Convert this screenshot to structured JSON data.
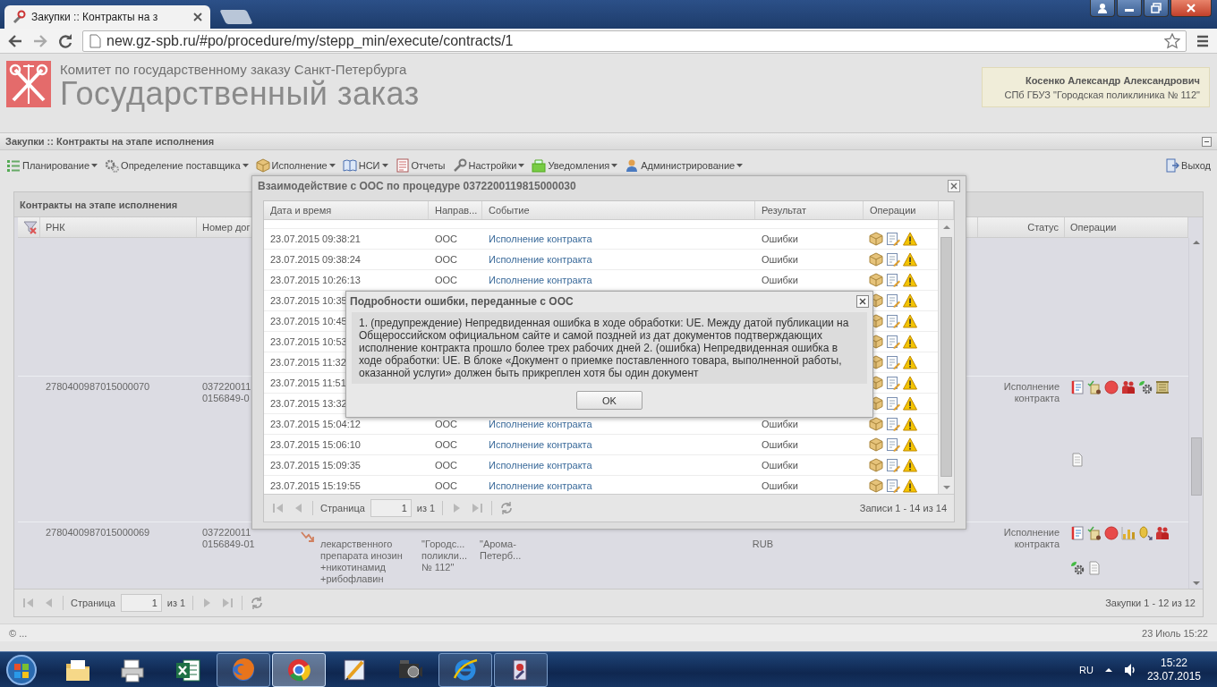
{
  "browser": {
    "tab_title": "Закупки :: Контракты на з",
    "url": "new.gz-spb.ru/#po/procedure/my/stepp_min/execute/contracts/1"
  },
  "header": {
    "org": "Комитет по государственному заказу Санкт-Петербурга",
    "title": "Государственный заказ",
    "user_name": "Косенко Александр Александрович",
    "user_org": "СПб ГБУЗ \"Городская поликлиника № 112\""
  },
  "panel_title": "Закупки :: Контракты на этапе исполнения",
  "menu": [
    {
      "label": "Планирование",
      "dropdown": true
    },
    {
      "label": "Определение поставщика",
      "dropdown": true
    },
    {
      "label": "Исполнение",
      "dropdown": true
    },
    {
      "label": "НСИ",
      "dropdown": true
    },
    {
      "label": "Отчеты",
      "dropdown": false
    },
    {
      "label": "Настройки",
      "dropdown": true
    },
    {
      "label": "Уведомления",
      "dropdown": true
    },
    {
      "label": "Администрирование",
      "dropdown": true
    }
  ],
  "logout": "Выход",
  "contracts": {
    "title": "Контракты на этапе исполнения",
    "columns": [
      "РНК",
      "Номер дог",
      "Статус",
      "Операции"
    ],
    "rows": [
      {
        "rnk": "2780400987015000070",
        "number": [
          "037220011",
          "0156849-0"
        ],
        "status": [
          "Исполнение",
          "контракта"
        ]
      },
      {
        "rnk": "2780400987015000069",
        "number": [
          "037220011",
          "0156849-01"
        ],
        "trend_icon": true,
        "subject": [
          "лекарственного",
          "препарата инозин",
          "+никотинамид",
          "+рибофлавин"
        ],
        "customer": [
          "\"Городс...",
          "поликли...",
          "№ 112\""
        ],
        "supplier": [
          "\"Арома-",
          "Петерб..."
        ],
        "price": [
          "RUB"
        ],
        "status": [
          "Исполнение",
          "контракта"
        ]
      }
    ],
    "pager": {
      "page_label": "Страница",
      "page": "1",
      "of": "из 1",
      "summary": "Закупки 1 - 12 из 12"
    }
  },
  "dialog": {
    "title": "Взаимодействие с ООС по процедуре 0372200119815000030",
    "columns": [
      "Дата и время",
      "Направ...",
      "Событие",
      "Результат",
      "Операции"
    ],
    "rows": [
      {
        "time": "23.07.2015 09:38:21",
        "direction": "ООС",
        "event": "Исполнение контракта",
        "result": "Ошибки"
      },
      {
        "time": "23.07.2015 09:38:24",
        "direction": "ООС",
        "event": "Исполнение контракта",
        "result": "Ошибки"
      },
      {
        "time": "23.07.2015 10:26:13",
        "direction": "ООС",
        "event": "Исполнение контракта",
        "result": "Ошибки"
      },
      {
        "time": "23.07.2015 10:35"
      },
      {
        "time": "23.07.2015 10:45"
      },
      {
        "time": "23.07.2015 10:53"
      },
      {
        "time": "23.07.2015 11:32"
      },
      {
        "time": "23.07.2015 11:51"
      },
      {
        "time": "23.07.2015 13:32"
      },
      {
        "time": "23.07.2015 15:04:12",
        "direction": "ООС",
        "event": "Исполнение контракта",
        "result": "Ошибки"
      },
      {
        "time": "23.07.2015 15:06:10",
        "direction": "ООС",
        "event": "Исполнение контракта",
        "result": "Ошибки"
      },
      {
        "time": "23.07.2015 15:09:35",
        "direction": "ООС",
        "event": "Исполнение контракта",
        "result": "Ошибки"
      },
      {
        "time": "23.07.2015 15:19:55",
        "direction": "ООС",
        "event": "Исполнение контракта",
        "result": "Ошибки"
      }
    ],
    "pager": {
      "page_label": "Страница",
      "page": "1",
      "of": "из 1",
      "summary": "Записи 1 - 14 из 14"
    }
  },
  "error_modal": {
    "title": "Подробности ошибки, переданные с ООС",
    "message": "1. (предупреждение) Непредвиденная ошибка в ходе обработки: UE. Между датой публикации на Общероссийском официальном сайте и самой поздней из дат документов подтверждающих исполнение контракта прошло более трех рабочих дней 2. (ошибка) Непредвиденная ошибка в ходе обработки: UE. В блоке «Документ о приемке поставленного товара, выполненной работы, оказанной услуги» должен быть прикреплен хотя бы один документ",
    "button": "OK"
  },
  "status_bar": {
    "left": "© ...",
    "right": "23 Июль 15:22"
  },
  "taskbar": {
    "apps": [
      {
        "kind": "folder",
        "running": false,
        "active": false
      },
      {
        "kind": "printer",
        "running": false,
        "active": false
      },
      {
        "kind": "excel",
        "running": false,
        "active": false
      },
      {
        "kind": "firefox",
        "running": true,
        "active": false
      },
      {
        "kind": "chrome",
        "running": true,
        "active": true
      },
      {
        "kind": "pen",
        "running": false,
        "active": false
      },
      {
        "kind": "film",
        "running": false,
        "active": false
      },
      {
        "kind": "ie",
        "running": true,
        "active": false
      },
      {
        "kind": "app",
        "running": true,
        "active": false
      }
    ],
    "language": "RU",
    "time": "15:22",
    "date": "23.07.2015"
  }
}
